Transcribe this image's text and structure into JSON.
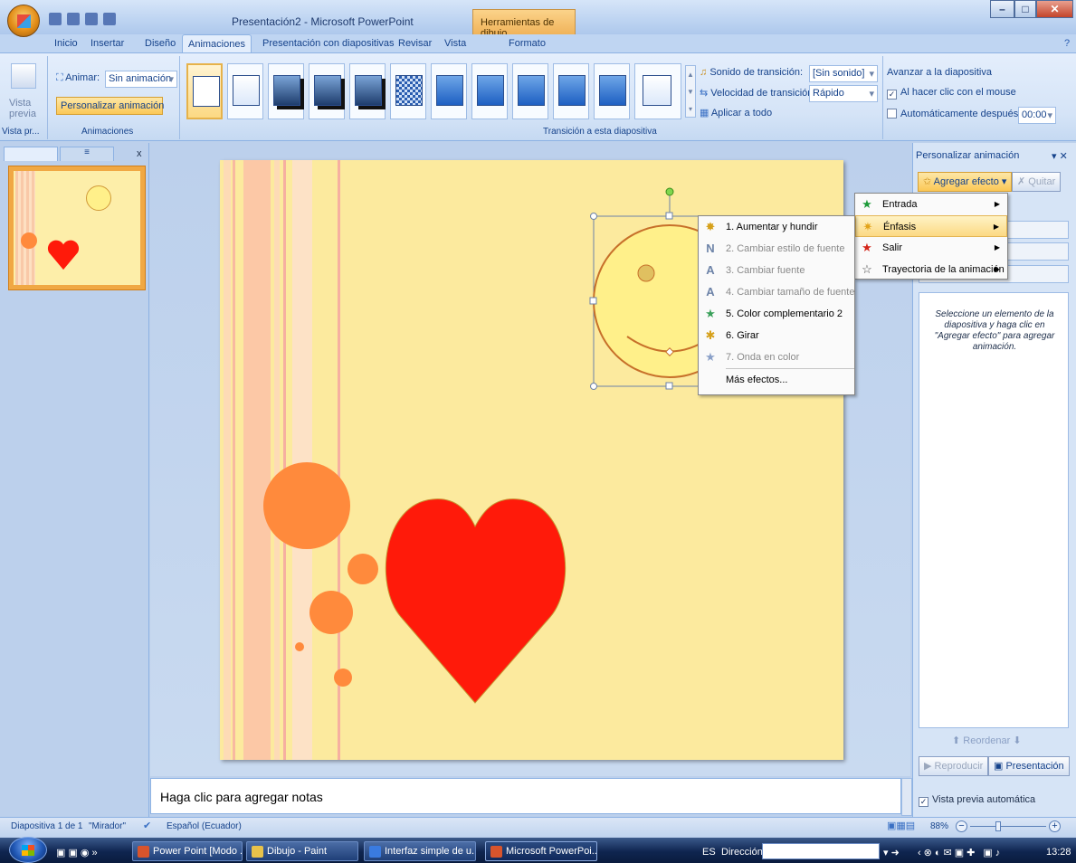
{
  "window": {
    "title": "Presentación2 - Microsoft PowerPoint",
    "context_tab": "Herramientas de dibujo"
  },
  "tabs": [
    "Inicio",
    "Insertar",
    "Diseño",
    "Animaciones",
    "Presentación con diapositivas",
    "Revisar",
    "Vista",
    "Formato"
  ],
  "ribbon": {
    "preview": {
      "label_line1": "Vista",
      "label_line2": "previa",
      "group": "Vista pr..."
    },
    "animate_label": "Animar:",
    "animate_value": "Sin animación",
    "custom_animation": "Personalizar animación",
    "animations_group": "Animaciones",
    "transition_sound_label": "Sonido de transición:",
    "transition_sound_value": "[Sin sonido]",
    "transition_speed_label": "Velocidad de transición:",
    "transition_speed_value": "Rápido",
    "apply_all": "Aplicar a todo",
    "transition_group": "Transición a esta diapositiva",
    "advance_label": "Avanzar a la diapositiva",
    "on_click_label": "Al hacer clic con el mouse",
    "auto_after_label": "Automáticamente después de:",
    "auto_after_value": "00:00"
  },
  "slides_panel": {
    "slide_number": "1",
    "close": "x"
  },
  "notes": {
    "placeholder": "Haga clic para agregar notas"
  },
  "task_pane": {
    "title": "Personalizar animación",
    "add_effect": "Agregar efecto",
    "remove": "Quitar",
    "hint": "Seleccione un elemento de la diapositiva y haga clic en \"Agregar efecto\" para agregar animación.",
    "reorder": "Reordenar",
    "play": "Reproducir",
    "slideshow": "Presentación",
    "autopreview": "Vista previa automática"
  },
  "effect_menu": {
    "items": [
      {
        "label": "Entrada",
        "icon": "entrance-star-icon"
      },
      {
        "label": "Énfasis",
        "icon": "emphasis-star-icon",
        "selected": true
      },
      {
        "label": "Salir",
        "icon": "exit-star-icon"
      },
      {
        "label": "Trayectoria de la animación",
        "icon": "motion-path-icon"
      }
    ]
  },
  "emphasis_menu": {
    "items": [
      {
        "label": "1. Aumentar y hundir",
        "enabled": true,
        "icon": "A"
      },
      {
        "label": "2. Cambiar estilo de fuente",
        "enabled": false,
        "icon": "N"
      },
      {
        "label": "3. Cambiar fuente",
        "enabled": false,
        "icon": "A"
      },
      {
        "label": "4. Cambiar tamaño de fuente",
        "enabled": false,
        "icon": "A"
      },
      {
        "label": "5. Color complementario 2",
        "enabled": true,
        "icon": "★"
      },
      {
        "label": "6. Girar",
        "enabled": true,
        "icon": "✱"
      },
      {
        "label": "7. Onda en color",
        "enabled": false,
        "icon": "★"
      },
      {
        "label": "Más efectos...",
        "enabled": true,
        "icon": ""
      }
    ]
  },
  "statusbar": {
    "slide": "Diapositiva 1 de 1",
    "theme": "\"Mirador\"",
    "language": "Español (Ecuador)",
    "zoom": "88%"
  },
  "taskbar": {
    "items": [
      "Power Point [Modo ...",
      "Dibujo - Paint",
      "Interfaz simple de u...",
      "Microsoft PowerPoi..."
    ],
    "lang": "ES",
    "address_label": "Dirección",
    "time": "13:28"
  }
}
